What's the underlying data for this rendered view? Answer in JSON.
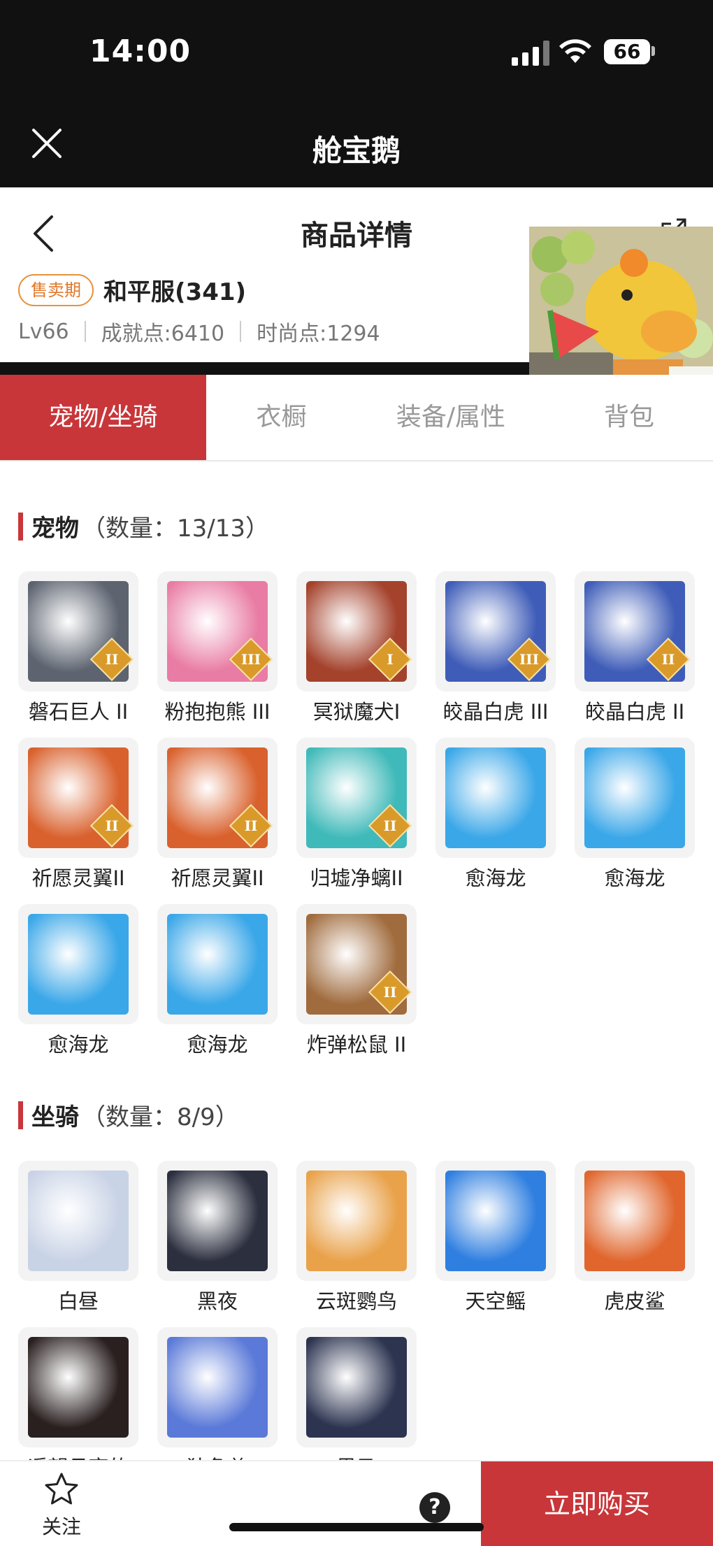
{
  "status_bar": {
    "time": "14:00",
    "battery": "66"
  },
  "mini_program": {
    "title": "舱宝鹅"
  },
  "product": {
    "page_title": "商品详情",
    "sale_badge": "售卖期",
    "server_name": "和平服(341)",
    "level": "Lv66",
    "achievement": "成就点:6410",
    "fashion": "时尚点:1294"
  },
  "tabs": [
    {
      "label": "宠物/坐骑",
      "active": true
    },
    {
      "label": "衣橱",
      "active": false
    },
    {
      "label": "装备/属性",
      "active": false
    },
    {
      "label": "背包",
      "active": false
    }
  ],
  "pets": {
    "title": "宠物",
    "count": "（数量：13/13）",
    "items": [
      {
        "name": "磐石巨人 II",
        "rank": "II",
        "color": "#5d6470"
      },
      {
        "name": "粉抱抱熊 III",
        "rank": "III",
        "color": "#e97ca4"
      },
      {
        "name": "冥狱魔犬I",
        "rank": "I",
        "color": "#a4422c"
      },
      {
        "name": "皎晶白虎 III",
        "rank": "III",
        "color": "#3f5db8"
      },
      {
        "name": "皎晶白虎 II",
        "rank": "II",
        "color": "#3f5db8"
      },
      {
        "name": "祈愿灵翼II",
        "rank": "II",
        "color": "#d9612d"
      },
      {
        "name": "祈愿灵翼II",
        "rank": "II",
        "color": "#d9612d"
      },
      {
        "name": "归墟净螭II",
        "rank": "II",
        "color": "#3fb9b9"
      },
      {
        "name": "愈海龙",
        "rank": "",
        "color": "#3aa7e8"
      },
      {
        "name": "愈海龙",
        "rank": "",
        "color": "#3aa7e8"
      },
      {
        "name": "愈海龙",
        "rank": "",
        "color": "#3aa7e8"
      },
      {
        "name": "愈海龙",
        "rank": "",
        "color": "#3aa7e8"
      },
      {
        "name": "炸弹松鼠 II",
        "rank": "II",
        "color": "#a06b3d"
      }
    ]
  },
  "mounts": {
    "title": "坐骑",
    "count": "（数量：8/9）",
    "items": [
      {
        "name": "白昼",
        "color": "#c9d3e6"
      },
      {
        "name": "黑夜",
        "color": "#2b2f3e"
      },
      {
        "name": "云斑鹦鸟",
        "color": "#e9a24a"
      },
      {
        "name": "天空鳐",
        "color": "#2f7fe0"
      },
      {
        "name": "虎皮鲨",
        "color": "#e0662d"
      },
      {
        "name": "遥望月亮的",
        "color": "#2a2020"
      },
      {
        "name": "独角兽",
        "color": "#5a79d8"
      },
      {
        "name": "黑马",
        "color": "#2c3450"
      }
    ]
  },
  "bottom_bar": {
    "follow": "关注",
    "help": "?",
    "buy": "立即购买"
  },
  "colors": {
    "accent": "#c8363a",
    "badge": "#e0782a"
  }
}
